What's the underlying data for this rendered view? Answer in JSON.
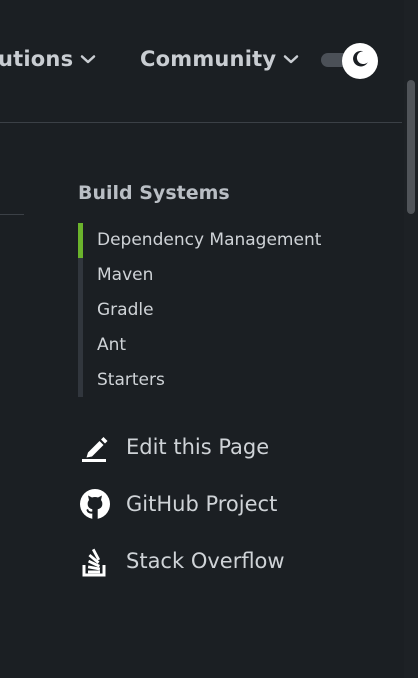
{
  "topnav": {
    "items": [
      {
        "label": "utions"
      },
      {
        "label": "Community"
      }
    ]
  },
  "sidebar": {
    "title": "Build Systems",
    "items": [
      {
        "label": "Dependency Management",
        "active": true
      },
      {
        "label": "Maven",
        "active": false
      },
      {
        "label": "Gradle",
        "active": false
      },
      {
        "label": "Ant",
        "active": false
      },
      {
        "label": "Starters",
        "active": false
      }
    ],
    "active_color": "#6bb32c"
  },
  "actions": [
    {
      "label": "Edit this Page",
      "icon": "edit-icon"
    },
    {
      "label": "GitHub Project",
      "icon": "github-icon"
    },
    {
      "label": "Stack Overflow",
      "icon": "stack-overflow-icon"
    }
  ],
  "theme": {
    "icon": "moon-icon"
  },
  "colors": {
    "background": "#1b1f23",
    "text": "#d2d6db",
    "accent": "#6bb32c"
  }
}
